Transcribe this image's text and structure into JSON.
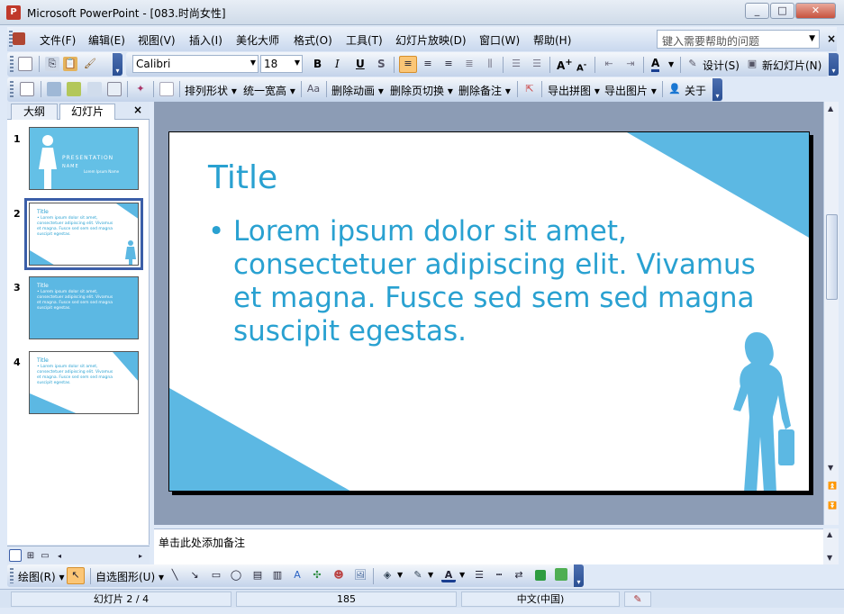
{
  "window": {
    "title": "Microsoft PowerPoint - [083.时尚女性]",
    "minimize": "_",
    "maximize": "□",
    "close": "✕"
  },
  "menu": {
    "items": [
      "文件(F)",
      "编辑(E)",
      "视图(V)",
      "插入(I)",
      "美化大师",
      "格式(O)",
      "工具(T)",
      "幻灯片放映(D)",
      "窗口(W)",
      "帮助(H)"
    ],
    "help_placeholder": "键入需要帮助的问题",
    "close": "×"
  },
  "format_toolbar": {
    "font": "Calibri",
    "size": "18",
    "bold": "B",
    "italic": "I",
    "underline": "U",
    "shadow": "S",
    "font_color": "A",
    "design": "设计(S)",
    "new_slide": "新幻灯片(N)"
  },
  "tools_toolbar": {
    "arrange": "排列形状",
    "unify": "统一宽高",
    "delete_animation": "删除动画",
    "delete_transition": "删除页切换",
    "delete_notes": "删除备注",
    "export_collage": "导出拼图",
    "export_images": "导出图片",
    "about": "关于"
  },
  "left_pane": {
    "tab_outline": "大纲",
    "tab_slides": "幻灯片",
    "close": "×",
    "slides": [
      {
        "num": "1",
        "title": "PRESENTATION",
        "name": "NAME",
        "sub": "Lorem Ipsum Name"
      },
      {
        "num": "2",
        "title": "Title",
        "body": "• Lorem ipsum dolor sit amet, consectetuer adipiscing elit. Vivamus et magna. Fusce sed sem sed magna suscipit egestas."
      },
      {
        "num": "3",
        "title": "Title",
        "body": "• Lorem ipsum dolor sit amet, consectetuer adipiscing elit. Vivamus et magna. Fusce sed sem sed magna suscipit egestas."
      },
      {
        "num": "4",
        "title": "Title",
        "body": "• Lorem ipsum dolor sit amet, consectetuer adipiscing elit. Vivamus et magna. Fusce sed sem sed magna suscipit egestas."
      }
    ]
  },
  "slide": {
    "title": "Title",
    "bullet": "•",
    "body": "Lorem ipsum dolor sit amet, consectetuer adipiscing elit. Vivamus et magna. Fusce sed sem sed magna suscipit egestas.",
    "accent": "#29a1d1"
  },
  "notes": {
    "placeholder": "单击此处添加备注"
  },
  "draw_toolbar": {
    "draw": "绘图(R)",
    "autoshapes": "自选图形(U)"
  },
  "status": {
    "slide": "幻灯片 2 / 4",
    "design": "185",
    "language": "中文(中国)"
  }
}
